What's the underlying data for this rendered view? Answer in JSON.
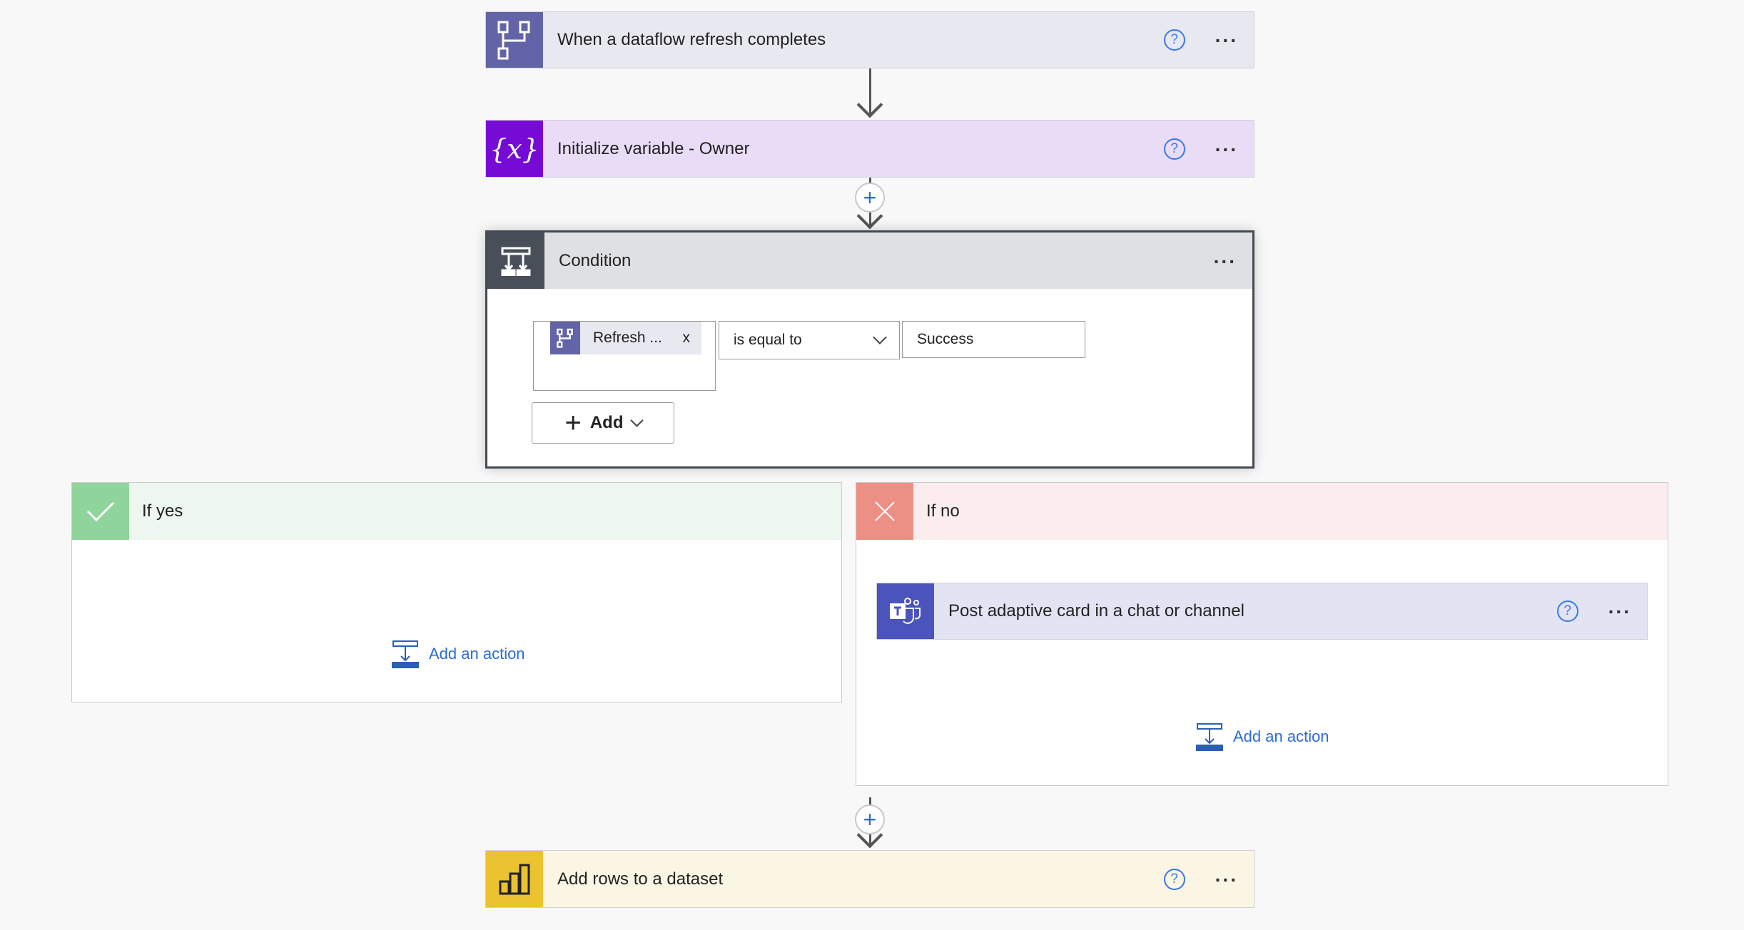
{
  "steps": {
    "trigger": {
      "title": "When a dataflow refresh completes",
      "icon": "dataflow-icon",
      "color": "#6264a7",
      "bg": "#e8e8f1"
    },
    "init_var": {
      "title": "Initialize variable - Owner",
      "icon": "variable-icon",
      "color": "#770bd6",
      "bg": "#e9dcf6"
    },
    "condition": {
      "title": "Condition",
      "icon": "condition-icon",
      "color": "#484f58",
      "bg": "#dfe0e2",
      "token": "Refresh ...",
      "token_remove": "x",
      "operator": "is equal to",
      "value": "Success",
      "add_label": "Add"
    },
    "if_yes": {
      "title": "If yes",
      "add_action": "Add an action",
      "color": "#8fd49b",
      "bg": "#edf7ef"
    },
    "if_no": {
      "title": "If no",
      "add_action": "Add an action",
      "color": "#ec8f85",
      "bg": "#fbeded",
      "action": {
        "title": "Post adaptive card in a chat or channel",
        "icon": "teams-icon",
        "color": "#4b53bc",
        "bg": "#e3e4f3"
      }
    },
    "add_rows": {
      "title": "Add rows to a dataset",
      "icon": "power-bi-icon",
      "color": "#ebc22f",
      "bg": "#fbf5e3"
    }
  },
  "help_glyph": "?",
  "more_glyph": "...",
  "plus_glyph": "+"
}
